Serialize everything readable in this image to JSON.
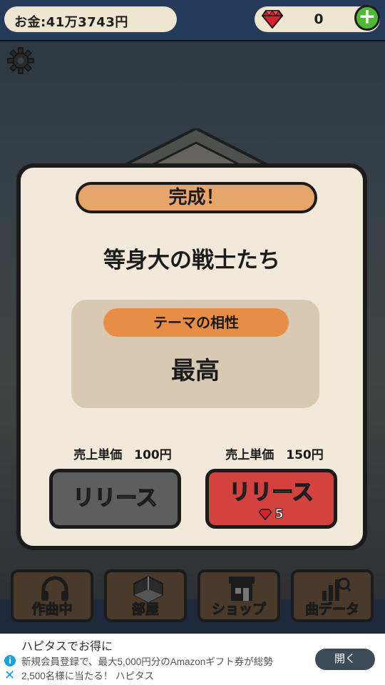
{
  "header": {
    "money_text": "お金:41万3743円",
    "gem_count": "0",
    "add_gems_label": "+"
  },
  "modal": {
    "title": "完成！",
    "song_title": "等身大の戦士たち",
    "theme_compat_label": "テーマの相性",
    "theme_compat_value": "最高",
    "options": [
      {
        "price_label": "売上単価　100円",
        "button_label": "リリース"
      },
      {
        "price_label": "売上単価　150円",
        "button_label": "リリース",
        "gem_cost": "5"
      }
    ]
  },
  "nav": {
    "items": [
      {
        "label": "作曲中",
        "icon": "headphones-icon"
      },
      {
        "label": "部屋",
        "icon": "room-icon"
      },
      {
        "label": "ショップ",
        "icon": "shop-icon"
      },
      {
        "label": "曲データ",
        "icon": "chart-search-icon"
      }
    ]
  },
  "ad": {
    "title": "ハピタスでお得に",
    "body_line1": "新規会員登録で、最大5,000円分のAmazonギフト券が総勢",
    "body_line2": "2,500名様に当たる！ ハピタス",
    "open_label": "開く",
    "info_glyph": "i",
    "close_glyph": "✕"
  },
  "colors": {
    "topbar": "#263a5a",
    "panel": "#f2e9da",
    "title_orange": "#e7a569",
    "theme_label_orange": "#e88d45",
    "release_gray": "#5e5e5e",
    "release_red": "#d4423f",
    "gem_red": "#d8202e",
    "plus_green": "#4fb834",
    "nav_brown": "#4a3a2c"
  }
}
